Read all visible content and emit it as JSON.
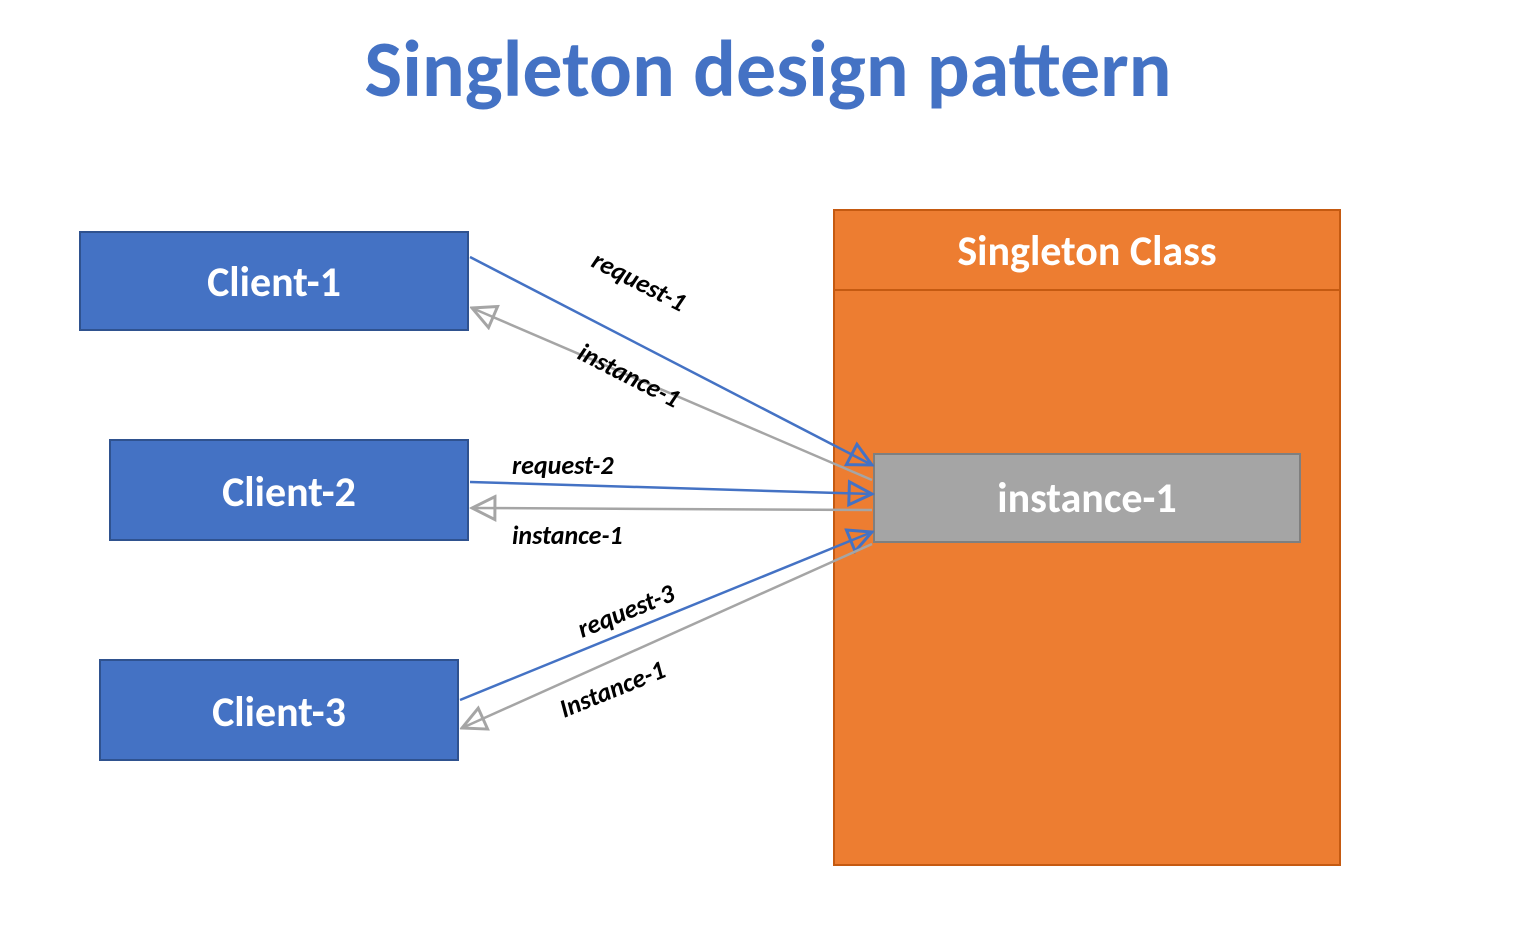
{
  "title": "Singleton design pattern",
  "colors": {
    "blue": "#4472C4",
    "blueStroke": "#2F528F",
    "orange": "#ED7D31",
    "orangeStroke": "#C55A11",
    "gray": "#A5A5A5",
    "grayStroke": "#7F7F7F",
    "arrowBlue": "#4472C4",
    "arrowGray": "#A5A5A5"
  },
  "clients": [
    {
      "label": "Client-1",
      "request": "request-1",
      "response": "instance-1"
    },
    {
      "label": "Client-2",
      "request": "request-2",
      "response": "instance-1"
    },
    {
      "label": "Client-3",
      "request": "request-3",
      "response": "Instance-1"
    }
  ],
  "singleton": {
    "title": "Singleton Class",
    "instance": "instance-1"
  }
}
